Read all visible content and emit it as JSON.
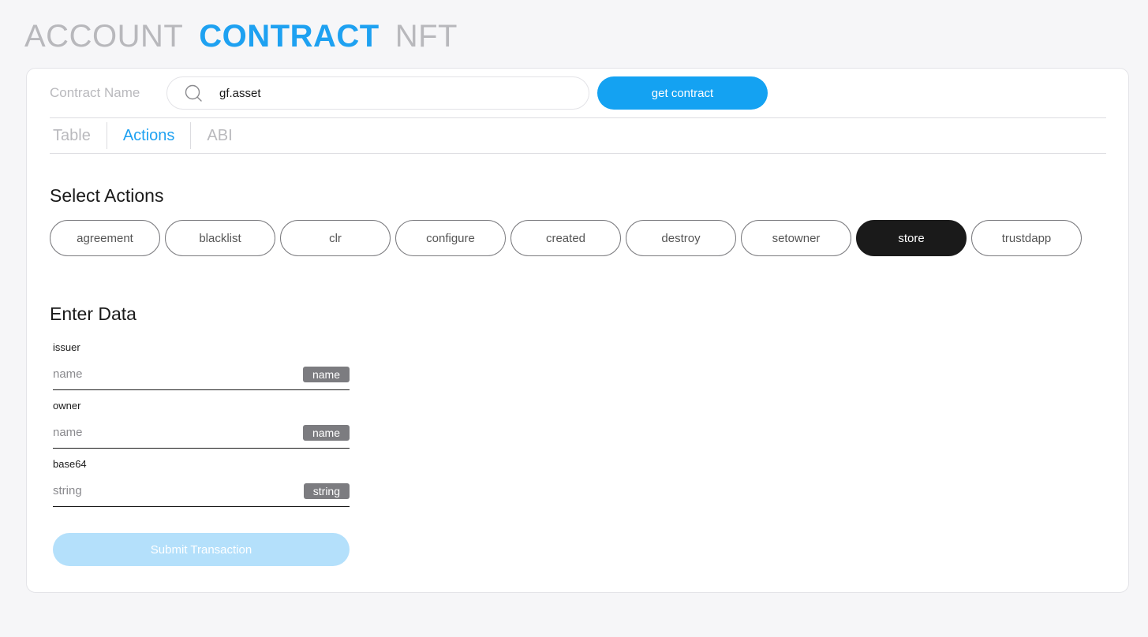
{
  "nav": {
    "items": [
      {
        "label": "ACCOUNT",
        "active": false
      },
      {
        "label": "CONTRACT",
        "active": true
      },
      {
        "label": "NFT",
        "active": false
      }
    ]
  },
  "contract": {
    "label": "Contract Name",
    "search_value": "gf.asset",
    "search_icon": "search-icon",
    "button_label": "get contract"
  },
  "tabs": [
    {
      "label": "Table",
      "active": false
    },
    {
      "label": "Actions",
      "active": true
    },
    {
      "label": "ABI",
      "active": false
    }
  ],
  "select_actions": {
    "title": "Select Actions",
    "actions": [
      "agreement",
      "blacklist",
      "clr",
      "configure",
      "created",
      "destroy",
      "setowner",
      "store",
      "trustdapp"
    ],
    "selected": "store"
  },
  "enter_data": {
    "title": "Enter Data",
    "fields": [
      {
        "label": "issuer",
        "placeholder": "name",
        "type": "name"
      },
      {
        "label": "owner",
        "placeholder": "name",
        "type": "name"
      },
      {
        "label": "base64",
        "placeholder": "string",
        "type": "string"
      }
    ],
    "submit_label": "Submit Transaction"
  },
  "colors": {
    "accent": "#1ea1f1",
    "button": "#14a2f2",
    "submit_disabled": "#b4e0fb",
    "selected_pill": "#1a1a1a",
    "badge": "#7c7c80"
  }
}
